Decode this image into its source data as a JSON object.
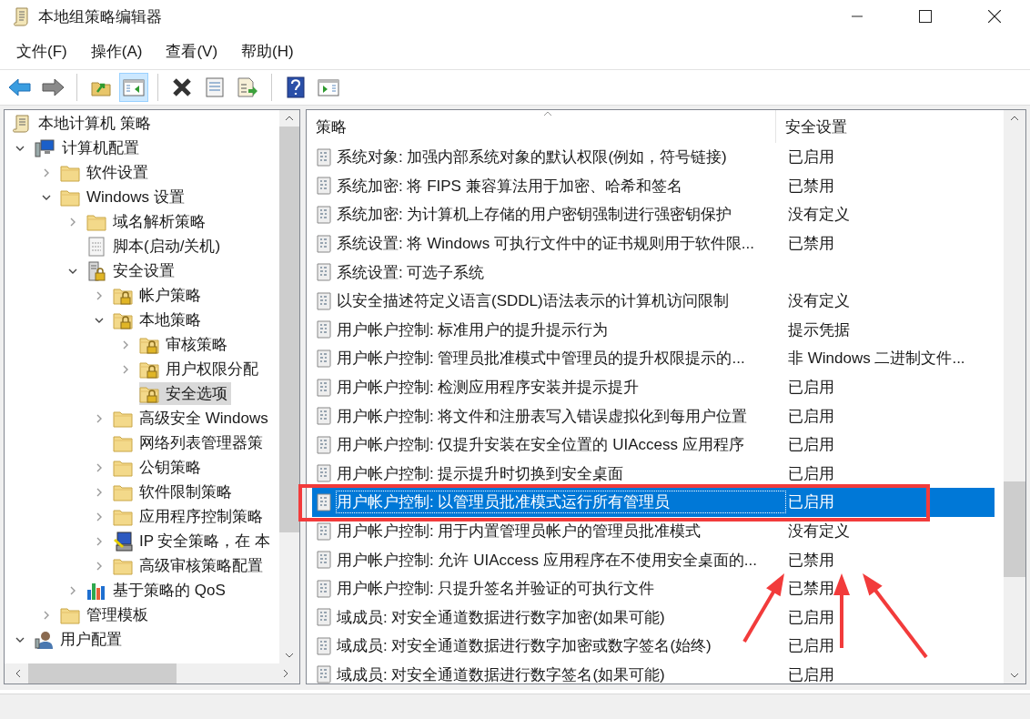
{
  "window": {
    "title": "本地组策略编辑器"
  },
  "menu": [
    "文件(F)",
    "操作(A)",
    "查看(V)",
    "帮助(H)"
  ],
  "toolbar": [
    {
      "pressed": false
    },
    {
      "pressed": false
    },
    {
      "pressed": false
    },
    {
      "pressed": true
    },
    {
      "pressed": false
    },
    {
      "pressed": false
    },
    {
      "pressed": false
    },
    {
      "pressed": false
    },
    {
      "pressed": false
    }
  ],
  "tree": [
    {
      "label": "本地计算机 策略",
      "kind": "policy",
      "selected": false,
      "children": [
        {
          "label": "计算机配置",
          "kind": "computer",
          "selected": false,
          "expanded": true,
          "children": [
            {
              "label": "软件设置",
              "kind": "folder",
              "selected": false,
              "expanded": false
            },
            {
              "label": "Windows 设置",
              "kind": "folder",
              "selected": false,
              "expanded": true,
              "children": [
                {
                  "label": "域名解析策略",
                  "kind": "folder",
                  "selected": false,
                  "expanded": false
                },
                {
                  "label": "脚本(启动/关机)",
                  "kind": "script",
                  "selected": false
                },
                {
                  "label": "安全设置",
                  "kind": "server",
                  "selected": false,
                  "expanded": true,
                  "children": [
                    {
                      "label": "帐户策略",
                      "kind": "locked-folder",
                      "selected": false,
                      "expanded": false
                    },
                    {
                      "label": "本地策略",
                      "kind": "locked-folder",
                      "selected": false,
                      "expanded": true,
                      "children": [
                        {
                          "label": "审核策略",
                          "kind": "locked-folder",
                          "selected": false,
                          "expanded": false
                        },
                        {
                          "label": "用户权限分配",
                          "kind": "locked-folder",
                          "selected": false,
                          "expanded": false
                        },
                        {
                          "label": "安全选项",
                          "kind": "locked-folder",
                          "selected": true
                        }
                      ]
                    },
                    {
                      "label": "高级安全 Windows",
                      "kind": "folder",
                      "selected": false,
                      "expanded": false
                    },
                    {
                      "label": "网络列表管理器策",
                      "kind": "folder",
                      "selected": false
                    },
                    {
                      "label": "公钥策略",
                      "kind": "folder",
                      "selected": false,
                      "expanded": false
                    },
                    {
                      "label": "软件限制策略",
                      "kind": "folder",
                      "selected": false,
                      "expanded": false
                    },
                    {
                      "label": "应用程序控制策略",
                      "kind": "folder",
                      "selected": false,
                      "expanded": false
                    },
                    {
                      "label": "IP 安全策略，在 本",
                      "kind": "ip",
                      "selected": false,
                      "expanded": false
                    },
                    {
                      "label": "高级审核策略配置",
                      "kind": "folder",
                      "selected": false,
                      "expanded": false
                    }
                  ]
                },
                {
                  "label": "基于策略的 QoS",
                  "kind": "chart",
                  "selected": false,
                  "expanded": false
                }
              ]
            },
            {
              "label": "管理模板",
              "kind": "folder",
              "selected": false,
              "expanded": false
            }
          ]
        },
        {
          "label": "用户配置",
          "kind": "user",
          "selected": false,
          "expanded": true
        }
      ]
    }
  ],
  "table": {
    "columns": [
      "策略",
      "安全设置"
    ],
    "rows": [
      {
        "policy": "系统对象: 加强内部系统对象的默认权限(例如，符号链接)",
        "setting": "已启用",
        "selected": false
      },
      {
        "policy": "系统加密: 将 FIPS 兼容算法用于加密、哈希和签名",
        "setting": "已禁用",
        "selected": false
      },
      {
        "policy": "系统加密: 为计算机上存储的用户密钥强制进行强密钥保护",
        "setting": "没有定义",
        "selected": false
      },
      {
        "policy": "系统设置: 将 Windows 可执行文件中的证书规则用于软件限...",
        "setting": "已禁用",
        "selected": false
      },
      {
        "policy": "系统设置: 可选子系统",
        "selected": false
      },
      {
        "policy": "以安全描述符定义语言(SDDL)语法表示的计算机访问限制",
        "setting": "没有定义",
        "selected": false
      },
      {
        "policy": "用户帐户控制: 标准用户的提升提示行为",
        "setting": "提示凭据",
        "selected": false
      },
      {
        "policy": "用户帐户控制: 管理员批准模式中管理员的提升权限提示的...",
        "setting": "非 Windows 二进制文件...",
        "selected": false
      },
      {
        "policy": "用户帐户控制: 检测应用程序安装并提示提升",
        "setting": "已启用",
        "selected": false
      },
      {
        "policy": "用户帐户控制: 将文件和注册表写入错误虚拟化到每用户位置",
        "setting": "已启用",
        "selected": false
      },
      {
        "policy": "用户帐户控制: 仅提升安装在安全位置的 UIAccess 应用程序",
        "setting": "已启用",
        "selected": false
      },
      {
        "policy": "用户帐户控制: 提示提升时切换到安全桌面",
        "setting": "已启用",
        "selected": false
      },
      {
        "policy": "用户帐户控制: 以管理员批准模式运行所有管理员",
        "setting": "已启用",
        "selected": true
      },
      {
        "policy": "用户帐户控制: 用于内置管理员帐户的管理员批准模式",
        "setting": "没有定义",
        "selected": false
      },
      {
        "policy": "用户帐户控制: 允许 UIAccess 应用程序在不使用安全桌面的...",
        "setting": "已禁用",
        "selected": false
      },
      {
        "policy": "用户帐户控制: 只提升签名并验证的可执行文件",
        "setting": "已禁用",
        "selected": false
      },
      {
        "policy": "域成员: 对安全通道数据进行数字加密(如果可能)",
        "setting": "已启用",
        "selected": false
      },
      {
        "policy": "域成员: 对安全通道数据进行数字加密或数字签名(始终)",
        "setting": "已启用",
        "selected": false
      },
      {
        "policy": "域成员: 对安全通道数据进行数字签名(如果可能)",
        "setting": "已启用",
        "selected": false
      }
    ]
  },
  "annotations": [
    {
      "kind": "box"
    },
    {
      "kind": "arrow"
    },
    {
      "kind": "arrow"
    },
    {
      "kind": "arrow"
    }
  ]
}
